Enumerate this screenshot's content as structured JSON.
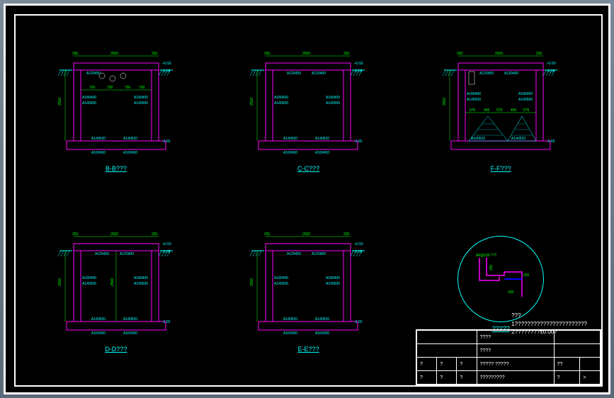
{
  "sections": [
    {
      "label": "B-B???",
      "top_dim": "250",
      "span": "2500",
      "span2": "250",
      "inner_dims": [
        "700",
        "700",
        "700",
        "700"
      ],
      "rebar": [
        "A120450",
        "A120400",
        "A180400",
        "A140500",
        "A140520",
        "A160450"
      ],
      "elev_top": "+0.50",
      "elev_mark": "-0.05",
      "elev_bot": "+0.00",
      "elev_ground": "-3.65",
      "height": "2500",
      "has_circles": true
    },
    {
      "label": "C-C???",
      "top_dim": "250",
      "span": "2500",
      "span2": "250",
      "rebar": [
        "A120450",
        "A120400",
        "A180400",
        "A140500",
        "A140520",
        "A160450"
      ],
      "elev_top": "+0.50",
      "elev_mark": "-0.05",
      "elev_bot": "+0.00",
      "elev_ground": "-3.65",
      "height": "2500"
    },
    {
      "label": "F-F???",
      "top_dim": "250",
      "span": "2500",
      "span2": "250",
      "inner_dims": [
        "575",
        "400",
        "575",
        "400",
        "575"
      ],
      "rebar": [
        "A120450",
        "A120400",
        "A180400",
        "A140500",
        "A140520",
        "A160450"
      ],
      "elev_top": "+0.50",
      "elev_mark": "-0.05",
      "elev_bot": "+0.00",
      "elev_ground": "-3.65",
      "height": "2500",
      "has_triangles": true
    },
    {
      "label": "D-D???",
      "top_dim": "250",
      "span": "2500",
      "span2": "250",
      "rebar": [
        "A120450",
        "A120400",
        "A180400",
        "A140500",
        "A140520",
        "A160450"
      ],
      "elev_top": "+0.50",
      "elev_mark": "-0.05",
      "elev_bot": "+0.00",
      "elev_ground": "-3.65",
      "height": "2500",
      "height2": "2500"
    },
    {
      "label": "E-E???",
      "top_dim": "250",
      "span": "2500",
      "span2": "250",
      "rebar": [
        "A120450",
        "A120400",
        "A180400",
        "A140500",
        "A140520",
        "A160450"
      ],
      "elev_top": "+0.50",
      "elev_mark": "-0.05",
      "elev_bot": "+0.00",
      "elev_ground": "-3.65",
      "height": "2500"
    }
  ],
  "detail": {
    "label": "?????",
    "dims": [
      "250",
      "100",
      "250"
    ],
    "note": "A6@100 ???"
  },
  "notes": {
    "title": "???",
    "line1": "1???????????????????????",
    "line2": "2????????±0.00?"
  },
  "title_block": {
    "r1c1": "????",
    "r1c2": "????",
    "r2c1": "?",
    "r2c2": "?",
    "r2c3": "?",
    "r2c4": "????? ?????",
    "r2c5": "??",
    "r3c1": "?",
    "r3c2": "?",
    "r3c3": "?",
    "r3c4": "?????????",
    "r3c5": "?",
    "r3c6": "?",
    "r3c7": ">"
  }
}
